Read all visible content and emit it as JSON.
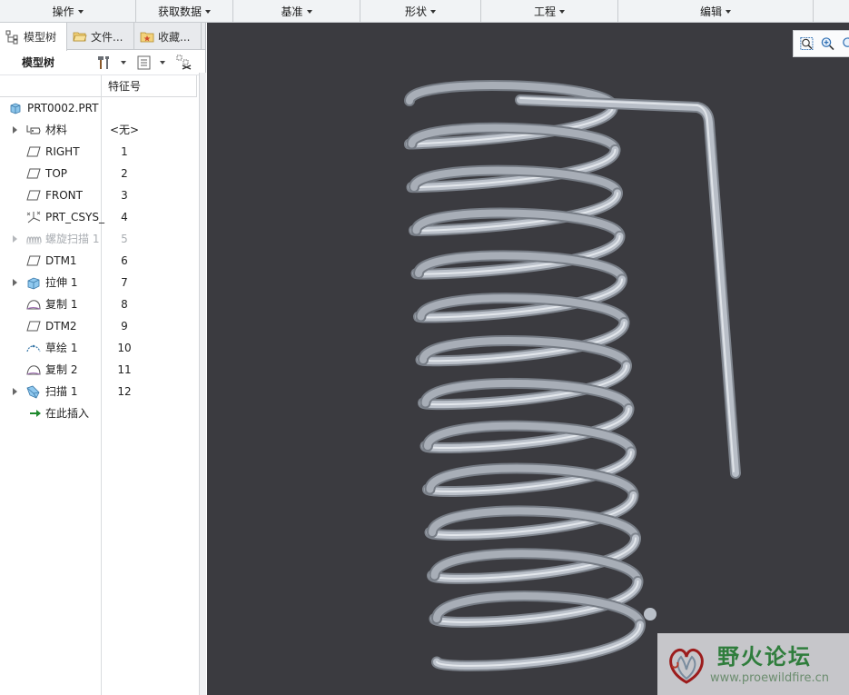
{
  "ribbon": {
    "groups": [
      "操作",
      "获取数据",
      "基准",
      "形状",
      "工程",
      "编辑"
    ]
  },
  "nav_tabs": [
    {
      "label": "模型树",
      "icon": "model-tree-icon"
    },
    {
      "label": "文件...",
      "icon": "folder-icon"
    },
    {
      "label": "收藏...",
      "icon": "favorites-icon"
    }
  ],
  "tree_toolbar": {
    "title": "模型树"
  },
  "tree_columns": {
    "feature_id": "特征号"
  },
  "tree": {
    "root": "PRT0002.PRT",
    "items": [
      {
        "label": "材料",
        "num": "<无>",
        "icon": "material-icon",
        "expandable": true
      },
      {
        "label": "RIGHT",
        "num": "1",
        "icon": "datum-plane-icon",
        "expandable": false
      },
      {
        "label": "TOP",
        "num": "2",
        "icon": "datum-plane-icon",
        "expandable": false
      },
      {
        "label": "FRONT",
        "num": "3",
        "icon": "datum-plane-icon",
        "expandable": false
      },
      {
        "label": "PRT_CSYS_",
        "num": "4",
        "icon": "csys-icon",
        "expandable": false
      },
      {
        "label": "螺旋扫描 1",
        "num": "5",
        "icon": "helical-sweep-icon",
        "expandable": true,
        "dim": true
      },
      {
        "label": "DTM1",
        "num": "6",
        "icon": "datum-plane-icon",
        "expandable": false
      },
      {
        "label": "拉伸 1",
        "num": "7",
        "icon": "extrude-icon",
        "expandable": true
      },
      {
        "label": "复制 1",
        "num": "8",
        "icon": "copy-surface-icon",
        "expandable": false
      },
      {
        "label": "DTM2",
        "num": "9",
        "icon": "datum-plane-icon",
        "expandable": false
      },
      {
        "label": "草绘 1",
        "num": "10",
        "icon": "sketch-icon",
        "expandable": false
      },
      {
        "label": "复制 2",
        "num": "11",
        "icon": "copy-surface-icon",
        "expandable": false
      },
      {
        "label": "扫描 1",
        "num": "12",
        "icon": "sweep-icon",
        "expandable": true
      },
      {
        "label": "在此插入",
        "num": "",
        "icon": "insert-here-arrow-icon",
        "expandable": false
      }
    ]
  },
  "watermark": {
    "title": "野火论坛",
    "url": "www.proewildfire.cn"
  },
  "colors": {
    "viewport_bg": "#3b3b40",
    "spring": "#b7bdc6",
    "insert_arrow": "#1f8a2e",
    "watermark_green": "#2f7d3c"
  }
}
